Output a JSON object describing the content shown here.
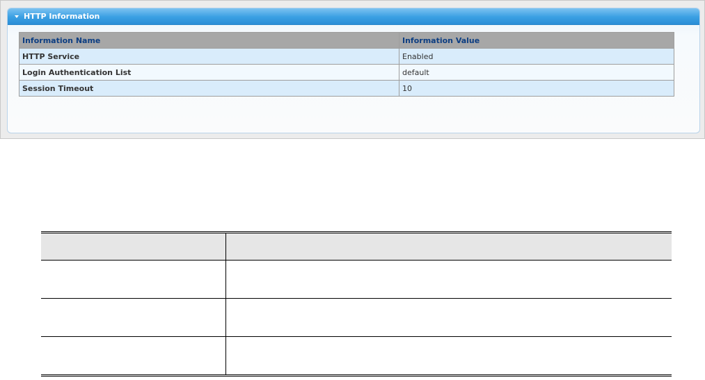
{
  "panel": {
    "title": "HTTP Information"
  },
  "info_table": {
    "headers": [
      "Information Name",
      "Information Value"
    ],
    "rows": [
      {
        "name": "HTTP Service",
        "value": "Enabled"
      },
      {
        "name": "Login Authentication List",
        "value": "default"
      },
      {
        "name": "Session Timeout",
        "value": "10"
      }
    ]
  },
  "colors": {
    "header_blue": "#3a9fe3",
    "table_header_gray": "#a7a7a7",
    "table_header_text": "#0d3e82",
    "row_blue": "#d9ecfb",
    "row_light": "#f2f9fe"
  },
  "icons": {
    "collapse": "triangle-down-icon"
  }
}
